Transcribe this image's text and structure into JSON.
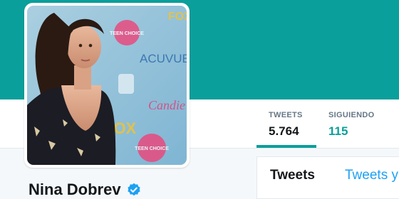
{
  "profile": {
    "name": "Nina Dobrev",
    "verified": true,
    "photo_alt": "profile-photo",
    "backdrop_logos": [
      "TEEN CHOICE",
      "ACUVUE",
      "FOX",
      "Candie's"
    ]
  },
  "stats": [
    {
      "label": "TWEETS",
      "value": "5.764",
      "active": true
    },
    {
      "label": "SIGUIENDO",
      "value": "115",
      "active": false
    }
  ],
  "tabs": {
    "tweets": "Tweets",
    "tweets_and_replies": "Tweets y"
  },
  "colors": {
    "banner": "#0a9f9b",
    "accent": "#0a9f9b",
    "link": "#1da1f2",
    "verified": "#1da1f2"
  }
}
